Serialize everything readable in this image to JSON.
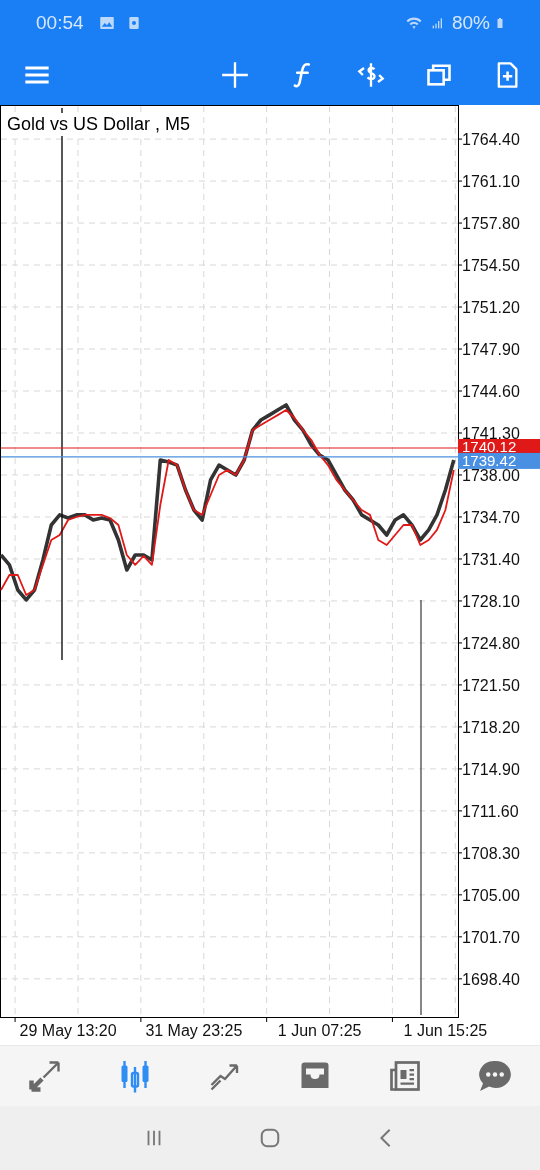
{
  "status_bar": {
    "time": "00:54",
    "battery": "80%"
  },
  "toolbar": {
    "buttons": [
      {
        "kind": "crosshair"
      },
      {
        "kind": "function"
      },
      {
        "kind": "trade"
      },
      {
        "kind": "windows"
      },
      {
        "kind": "new"
      }
    ]
  },
  "chart": {
    "title": "Gold vs US Dollar , M5",
    "price_tags": [
      {
        "label": "1740.12",
        "color": "#e01818"
      },
      {
        "label": "1739.42",
        "color": "#4a90e2"
      }
    ],
    "chart_data": {
      "type": "line",
      "ylim": [
        1695.4,
        1767.0
      ],
      "grid": true,
      "categories": [
        null,
        null,
        null,
        null,
        null,
        null,
        null,
        null,
        "29 May 13:20",
        null,
        null,
        null,
        null,
        null,
        null,
        null,
        null,
        null,
        null,
        null,
        null,
        null,
        null,
        "31 May 23:25",
        null,
        null,
        null,
        null,
        null,
        null,
        null,
        null,
        null,
        null,
        null,
        null,
        null,
        null,
        "1 Jun 07:25",
        null,
        null,
        null,
        null,
        null,
        null,
        null,
        null,
        null,
        null,
        null,
        null,
        null,
        null,
        "1 Jun 15:25",
        null
      ],
      "yticks": [
        {
          "value": 1764.4,
          "label": "1764.40"
        },
        {
          "value": 1761.1,
          "label": "1761.10"
        },
        {
          "value": 1757.8,
          "label": "1757.80"
        },
        {
          "value": 1754.5,
          "label": "1754.50"
        },
        {
          "value": 1751.2,
          "label": "1751.20"
        },
        {
          "value": 1747.9,
          "label": "1747.90"
        },
        {
          "value": 1744.6,
          "label": "1744.60"
        },
        {
          "value": 1741.3,
          "label": "1741.30"
        },
        {
          "value": 1738.0,
          "label": "1738.00"
        },
        {
          "value": 1734.7,
          "label": "1734.70"
        },
        {
          "value": 1731.4,
          "label": "1731.40"
        },
        {
          "value": 1728.1,
          "label": "1728.10"
        },
        {
          "value": 1724.8,
          "label": "1724.80"
        },
        {
          "value": 1721.5,
          "label": "1721.50"
        },
        {
          "value": 1718.2,
          "label": "1718.20"
        },
        {
          "value": 1714.9,
          "label": "1714.90"
        },
        {
          "value": 1711.6,
          "label": "1711.60"
        },
        {
          "value": 1708.3,
          "label": "1708.30"
        },
        {
          "value": 1705.0,
          "label": "1705.00"
        },
        {
          "value": 1701.7,
          "label": "1701.70"
        },
        {
          "value": 1698.4,
          "label": "1698.40"
        }
      ],
      "series": [
        {
          "color": "#333333",
          "values": [
            1731.71,
            1730.93,
            1728.96,
            1728.18,
            1728.96,
            1731.32,
            1734.07,
            1734.86,
            1734.62,
            1734.86,
            1734.86,
            1734.46,
            1734.62,
            1734.46,
            1732.89,
            1730.53,
            1731.71,
            1731.71,
            1731.32,
            1739.18,
            1739.02,
            1738.78,
            1736.82,
            1735.25,
            1734.46,
            1737.61,
            1738.78,
            1738.39,
            1738.0,
            1739.18,
            1741.53,
            1742.32,
            1742.71,
            1743.11,
            1743.5,
            1742.32,
            1741.53,
            1740.36,
            1739.57,
            1739.18,
            1738.0,
            1736.82,
            1736.03,
            1734.86,
            1734.46,
            1734.07,
            1733.28,
            1734.46,
            1734.86,
            1734.07,
            1732.89,
            1733.68,
            1734.86,
            1736.82,
            1739.18
          ]
        },
        {
          "color": "#e01818",
          "values": [
            1728.96,
            1730.14,
            1730.14,
            1728.57,
            1728.96,
            1730.93,
            1732.89,
            1733.28,
            1734.46,
            1734.7,
            1734.86,
            1734.86,
            1734.86,
            1734.62,
            1734.07,
            1731.71,
            1730.93,
            1731.63,
            1730.93,
            1735.64,
            1739.18,
            1738.78,
            1736.82,
            1735.25,
            1734.86,
            1736.43,
            1738.0,
            1738.39,
            1738.0,
            1739.18,
            1741.53,
            1741.93,
            1742.32,
            1742.71,
            1743.11,
            1742.48,
            1741.53,
            1740.75,
            1739.57,
            1738.78,
            1737.61,
            1736.82,
            1736.03,
            1735.25,
            1734.86,
            1732.89,
            1732.5,
            1733.28,
            1734.07,
            1734.07,
            1732.5,
            1732.89,
            1733.68,
            1735.25,
            1738.39
          ]
        }
      ]
    }
  },
  "bottom_nav": [
    {
      "kind": "trade",
      "selected": false
    },
    {
      "kind": "chart",
      "selected": true
    },
    {
      "kind": "history",
      "selected": false
    },
    {
      "kind": "mailbox",
      "selected": false
    },
    {
      "kind": "news",
      "selected": false
    },
    {
      "kind": "chat",
      "selected": false
    }
  ],
  "system_nav": [
    {
      "kind": "recents"
    },
    {
      "kind": "home"
    },
    {
      "kind": "back"
    }
  ]
}
